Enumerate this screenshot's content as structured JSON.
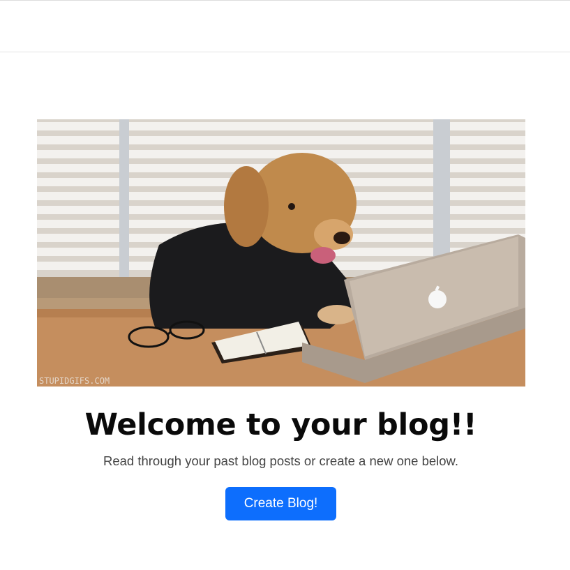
{
  "hero": {
    "image_watermark": "STUPIDGIFS.COM"
  },
  "main": {
    "title": "Welcome to your blog!!",
    "subtitle": "Read through your past blog posts or create a new one below.",
    "create_button_label": "Create Blog!"
  },
  "colors": {
    "primary": "#0d6efd",
    "text": "#0a0a0a",
    "muted": "#444444"
  }
}
